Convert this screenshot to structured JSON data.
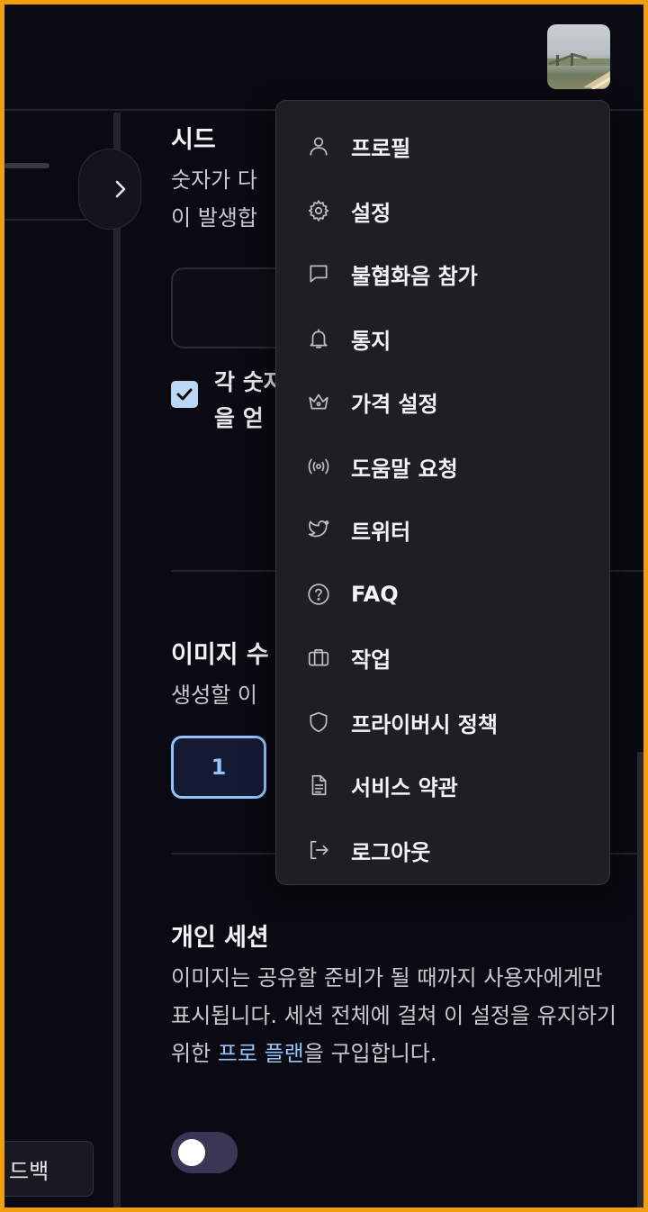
{
  "sidebar": {
    "feedback_label": "드백",
    "collapse_icon": "chevron-right-icon"
  },
  "main": {
    "seed": {
      "title": "시드",
      "desc_line1": "숫자가 다",
      "desc_line2": "이 발생합",
      "checkbox_line1": "각 숫자",
      "checkbox_line2": "을 얻",
      "checkbox_checked": true
    },
    "image_count": {
      "title": "이미지 수",
      "desc": "생성할 이",
      "selected": "1"
    },
    "private_session": {
      "title": "개인 세션",
      "desc_before": "이미지는 공유할 준비가 될 때까지 사용자에게만 표시됩니다. 세션 전체에 걸쳐 이 설정을 유지하기 위한 ",
      "link": "프로 플랜",
      "desc_after": "을 구입합니다.",
      "toggle_on": false
    }
  },
  "menu": {
    "items": [
      {
        "label": "프로필",
        "icon": "user-icon"
      },
      {
        "label": "설정",
        "icon": "gear-icon"
      },
      {
        "label": "불협화음 참가",
        "icon": "chat-bubble-icon"
      },
      {
        "label": "통지",
        "icon": "bell-icon"
      },
      {
        "label": "가격 설정",
        "icon": "crown-icon"
      },
      {
        "label": "도움말 요청",
        "icon": "broadcast-icon"
      },
      {
        "label": "트위터",
        "icon": "twitter-icon"
      },
      {
        "label": "FAQ",
        "icon": "question-circle-icon"
      },
      {
        "label": "작업",
        "icon": "briefcase-icon"
      },
      {
        "label": "프라이버시 정책",
        "icon": "shield-icon"
      },
      {
        "label": "서비스 약관",
        "icon": "document-icon"
      },
      {
        "label": "로그아웃",
        "icon": "logout-icon"
      }
    ]
  },
  "colors": {
    "background": "#0b0a12",
    "menu_bg": "#1f1f22",
    "accent": "#93c5fd",
    "frame_border": "#f59e0b"
  }
}
